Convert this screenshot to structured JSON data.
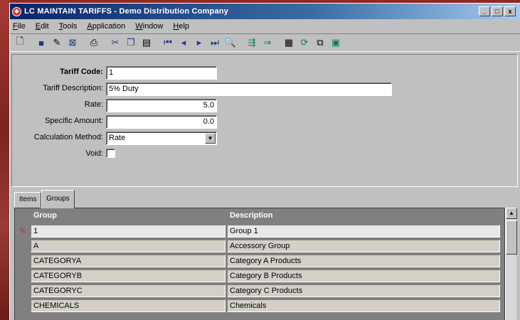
{
  "window": {
    "title": "LC MAINTAIN TARIFFS - Demo Distribution Company",
    "controls": {
      "minimize": "_",
      "maximize": "□",
      "close": "x"
    }
  },
  "menu": [
    {
      "prefix": "",
      "accel": "F",
      "rest": "ile"
    },
    {
      "prefix": "",
      "accel": "E",
      "rest": "dit"
    },
    {
      "prefix": "",
      "accel": "T",
      "rest": "ools"
    },
    {
      "prefix": "",
      "accel": "A",
      "rest": "pplication"
    },
    {
      "prefix": "",
      "accel": "W",
      "rest": "indow"
    },
    {
      "prefix": "",
      "accel": "H",
      "rest": "elp"
    }
  ],
  "toolbar": {
    "icons": [
      "new-icon",
      "save-icon",
      "edit-icon",
      "delete-icon",
      "print-icon",
      "cut-icon",
      "copy-icon",
      "paste-icon",
      "first-record-icon",
      "previous-record-icon",
      "next-record-icon",
      "last-record-icon",
      "search-icon",
      "insert-icon",
      "export-icon",
      "chart-icon",
      "refresh-icon",
      "attach-icon",
      "notes-icon"
    ]
  },
  "form": {
    "tariff_code_label": "Tariff Code:",
    "tariff_code": "1",
    "tariff_description_label": "Tariff Description:",
    "tariff_description": "5% Duty",
    "rate_label": "Rate:",
    "rate": "5.0",
    "specific_amount_label": "Specific Amount:",
    "specific_amount": "0.0",
    "calculation_method_label": "Calculation Method:",
    "calculation_method": "Rate",
    "void_label": "Void:"
  },
  "tabs": [
    {
      "label": "Items",
      "active": false
    },
    {
      "label": "Groups",
      "active": true
    }
  ],
  "grid": {
    "columns": [
      "Group",
      "Description"
    ],
    "rows": [
      {
        "group": "1",
        "description": "Group 1"
      },
      {
        "group": "A",
        "description": "Accessory Group"
      },
      {
        "group": "CATEGORYA",
        "description": "Category A Products"
      },
      {
        "group": "CATEGORYB",
        "description": "Category B Products"
      },
      {
        "group": "CATEGORYC",
        "description": "Category C Products"
      },
      {
        "group": "CHEMICALS",
        "description": "Chemicals"
      }
    ]
  },
  "colors": {
    "titlebar_start": "#0a246a",
    "titlebar_end": "#a6caf0",
    "window_face": "#c0c0c0",
    "grid_header": "#808080",
    "selector_arrow": "#c0302a"
  }
}
